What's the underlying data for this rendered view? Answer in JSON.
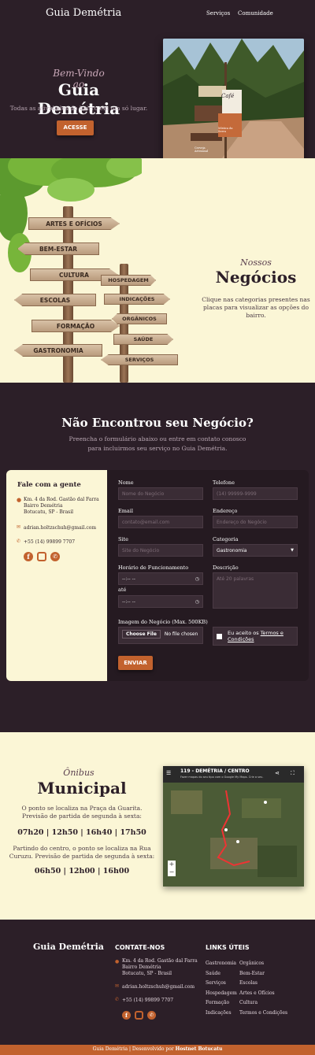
{
  "nav": {
    "brand": "Guia Demétria",
    "links": [
      "Serviços",
      "Comunidade"
    ]
  },
  "hero": {
    "script": "Bem-Vindo ao",
    "title": "Guia Demétria",
    "subtitle": "Todas as atividades do bairro em um só lugar.",
    "button": "ACESSE",
    "photo_signs": [
      "Café",
      "Mística da Serra",
      "Cerveja Artesanal"
    ]
  },
  "negocios": {
    "script": "Nossos",
    "title": "Negócios",
    "text": "Clique nas categorias presentes nas placas para visualizar as opções do bairro.",
    "signs_left": [
      "ARTES E OFÍCIOS",
      "BEM-ESTAR",
      "CULTURA",
      "ESCOLAS",
      "FORMAÇÃO",
      "GASTRONOMIA"
    ],
    "signs_right": [
      "HOSPEDAGEM",
      "INDICAÇÕES",
      "ORGÂNICOS",
      "SAÚDE",
      "SERVIÇOS"
    ]
  },
  "form_section": {
    "title": "Não Encontrou seu Negócio?",
    "subtitle_1": "Preencha o formulário abaixo ou entre em contato conosco",
    "subtitle_2": "para incluirmos seu serviço no Guia Demétria.",
    "contact": {
      "title": "Fale com a gente",
      "address_1": "Km. 4 da Rod. Gastão dal Farra",
      "address_2": "Bairro Demétria",
      "address_3": "Botucatu, SP - Brasil",
      "email": "adrian.holtzschuh@gmail.com",
      "phone": "+55 (14) 99899 7707"
    },
    "fields": {
      "nome_label": "Nome",
      "nome_ph": "Nome do Negócio",
      "telefone_label": "Telefone",
      "telefone_ph": "(14) 99999-9999",
      "email_label": "Email",
      "email_ph": "contato@email.com",
      "endereco_label": "Endereço",
      "endereco_ph": "Endereço do Negócio",
      "site_label": "Site",
      "site_ph": "Site do Negócio",
      "categoria_label": "Categoria",
      "categoria_value": "Gastronomia",
      "horario_label": "Horário de Funcionamento",
      "time_value": "--:-- --",
      "ate": "até",
      "descricao_label": "Descrição",
      "descricao_ph": "Até 20 palavras",
      "imagem_label": "Imagem do Negócio (Max. 500KB)",
      "choose_file": "Choose File",
      "no_file": "No file chosen",
      "terms_prefix": "Eu aceito os",
      "terms_link": "Termos e Condições",
      "submit": "ENVIAR"
    }
  },
  "onibus": {
    "script": "Ônibus",
    "title": "Municipal",
    "text_1": "O ponto se localiza na Praça da Guarita. Previsão de partida de segunda à sexta:",
    "times_1": "07h20 | 12h50 | 16h40 | 17h50",
    "text_2": "Partindo do centro, o ponto se localiza na Rua Curuzu. Previsão de partida de segunda à sexta:",
    "times_2": "06h50 | 12h00 | 16h00",
    "map_title": "119 - DEMÉTRIA / CENTRO",
    "map_sub": "Fazer mapas do seu tipo com o Google My Maps. Crie a seu."
  },
  "footer": {
    "brand": "Guia Demétria",
    "contact_title": "CONTATE-NOS",
    "links_title": "LINKS ÚTEIS",
    "links_col1": [
      "Gastronomia",
      "Saúde",
      "Serviços",
      "Hospedagem",
      "Formação",
      "Indicações"
    ],
    "links_col2": [
      "Orgânicos",
      "Bem-Estar",
      "Escolas",
      "Artes e Ofícios",
      "Cultura",
      "Termos e Condições"
    ],
    "bottom_prefix": "Guia Demétria | Desenvolvido por",
    "bottom_author": "Hostnet Botucatu"
  },
  "colors": {
    "dark": "#2c1f28",
    "cream": "#fbf6d6",
    "accent": "#c2622e"
  }
}
